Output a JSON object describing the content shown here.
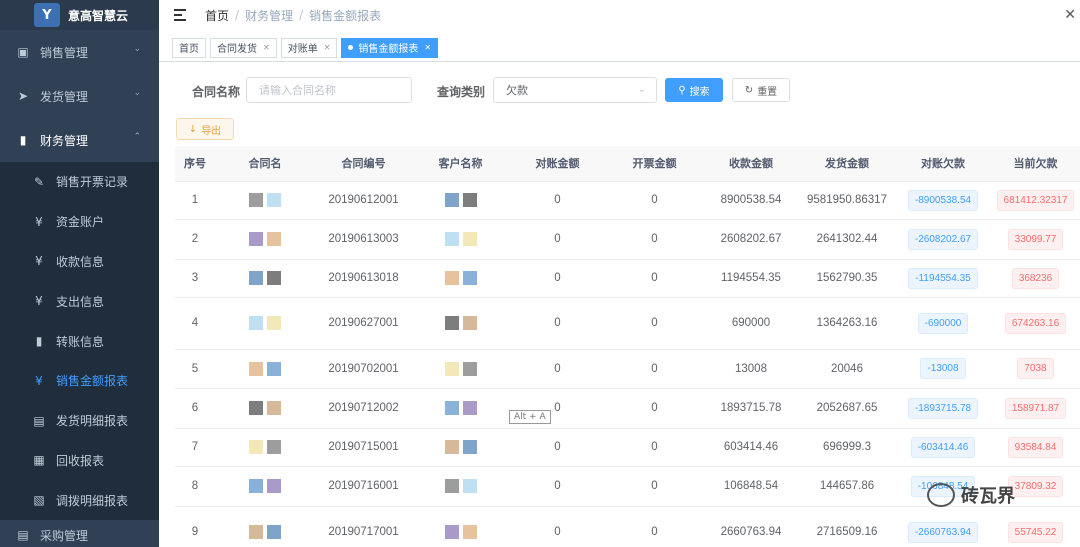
{
  "app": {
    "name": "意高智慧云",
    "logo_letter": "Y"
  },
  "sidebar": {
    "items": [
      {
        "label": "销售管理",
        "icon": "archive-icon"
      },
      {
        "label": "发货管理",
        "icon": "send-icon"
      },
      {
        "label": "财务管理",
        "icon": "bar-chart-icon"
      }
    ],
    "finance_sub": [
      {
        "label": "销售开票记录",
        "icon": "edit-icon"
      },
      {
        "label": "资金账户",
        "icon": "yen-icon"
      },
      {
        "label": "收款信息",
        "icon": "yen-icon"
      },
      {
        "label": "支出信息",
        "icon": "yen-icon"
      },
      {
        "label": "转账信息",
        "icon": "info-icon"
      },
      {
        "label": "销售金额报表",
        "icon": "yen-icon",
        "active": true
      },
      {
        "label": "发货明细报表",
        "icon": "document-icon"
      },
      {
        "label": "回收报表",
        "icon": "scan-icon"
      },
      {
        "label": "调拨明细报表",
        "icon": "clipboard-icon"
      }
    ],
    "last_item": {
      "label": "采购管理",
      "icon": "cart-icon"
    }
  },
  "breadcrumb": [
    "首页",
    "财务管理",
    "销售金额报表"
  ],
  "tags": [
    "首页",
    "合同发货",
    "对账单",
    "销售金额报表"
  ],
  "form": {
    "contract_label": "合同名称",
    "contract_placeholder": "请输入合同名称",
    "type_label": "查询类别",
    "type_value": "欠款",
    "search_label": "搜索",
    "reset_label": "重置",
    "export_label": "导出"
  },
  "table": {
    "headers": [
      "序号",
      "合同名",
      "合同编号",
      "客户名称",
      "对账金额",
      "开票金额",
      "收款金额",
      "发货金额",
      "对账欠款",
      "当前欠款"
    ],
    "rows": [
      {
        "no": "1",
        "code": "20190612001",
        "recon": "0",
        "invoice": "0",
        "received": "8900538.54",
        "shipped": "9581950.86317",
        "recon_debt": "-8900538.54",
        "current_debt": "681412.32317"
      },
      {
        "no": "2",
        "code": "20190613003",
        "recon": "0",
        "invoice": "0",
        "received": "2608202.67",
        "shipped": "2641302.44",
        "recon_debt": "-2608202.67",
        "current_debt": "33099.77"
      },
      {
        "no": "3",
        "code": "20190613018",
        "recon": "0",
        "invoice": "0",
        "received": "1194554.35",
        "shipped": "1562790.35",
        "recon_debt": "-1194554.35",
        "current_debt": "368236"
      },
      {
        "no": "4",
        "code": "20190627001",
        "recon": "0",
        "invoice": "0",
        "received": "690000",
        "shipped": "1364263.16",
        "recon_debt": "-690000",
        "current_debt": "674263.16"
      },
      {
        "no": "5",
        "code": "20190702001",
        "recon": "0",
        "invoice": "0",
        "received": "13008",
        "shipped": "20046",
        "recon_debt": "-13008",
        "current_debt": "7038"
      },
      {
        "no": "6",
        "code": "20190712002",
        "recon": "0",
        "invoice": "0",
        "received": "1893715.78",
        "shipped": "2052687.65",
        "recon_debt": "-1893715.78",
        "current_debt": "158971.87"
      },
      {
        "no": "7",
        "code": "20190715001",
        "recon": "0",
        "invoice": "0",
        "received": "603414.46",
        "shipped": "696999.3",
        "recon_debt": "-603414.46",
        "current_debt": "93584.84"
      },
      {
        "no": "8",
        "code": "20190716001",
        "recon": "0",
        "invoice": "0",
        "received": "106848.54",
        "shipped": "144657.86",
        "recon_debt": "-106848.54",
        "current_debt": "37809.32"
      },
      {
        "no": "9",
        "code": "20190717001",
        "recon": "0",
        "invoice": "0",
        "received": "2660763.94",
        "shipped": "2716509.16",
        "recon_debt": "-2660763.94",
        "current_debt": "55745.22"
      }
    ]
  },
  "overlay": {
    "tooltip": "Alt + A",
    "watermark": "砖瓦界"
  }
}
